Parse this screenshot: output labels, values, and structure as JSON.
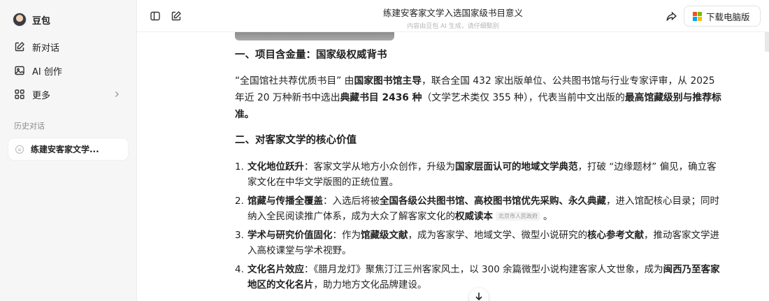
{
  "sidebar": {
    "brand": "豆包",
    "items": [
      {
        "label": "新对话",
        "icon": "edit-icon"
      },
      {
        "label": "AI 创作",
        "icon": "image-icon"
      },
      {
        "label": "更多",
        "icon": "grid-icon"
      }
    ],
    "history_label": "历史对话",
    "history": [
      {
        "label": "练建安客家文学..."
      }
    ]
  },
  "header": {
    "title": "练建安客家文学入选国家级书目意义",
    "subtitle": "内容由豆包 AI 生成，请仔细甄别",
    "download_label": "下载电脑版"
  },
  "article": {
    "h1": "一、项目含金量：国家级权威背书",
    "p1": {
      "a": "“全国馆社共荐优质书目” 由",
      "b": "国家图书馆主导",
      "c": "，联合全国 432 家出版单位、公共图书馆与行业专家评审，从 2025 年近 20 万种新书中选出",
      "d": "典藏书目 2436 种",
      "e": "（文学艺术类仅 355 种），代表当前中文出版的",
      "f": "最高馆藏级别与推荐标准。"
    },
    "h2": "二、对客家文学的核心价值",
    "list": [
      {
        "num": "1.",
        "bold": "文化地位跃升",
        "t1": "：客家文学从地方小众创作，升级为",
        "b2": "国家层面认可的地域文学典范",
        "t2": "，打破 “边缘题材” 偏见，确立客家文化在中华文学版图的正统位置。"
      },
      {
        "num": "2.",
        "bold": "馆藏与传播全覆盖",
        "t1": "：入选后将被",
        "b2": "全国各级公共图书馆、高校图书馆优先采购、永久典藏",
        "t2": "，进入馆配核心目录；同时纳入全民阅读推广体系，成为大众了解客家文化的",
        "b3": "权威读本",
        "tag": "北京市人民政府",
        "t3": "。"
      },
      {
        "num": "3.",
        "bold": "学术与研究价值固化",
        "t1": "：作为",
        "b2": "馆藏级文献",
        "t2": "，成为客家学、地域文学、微型小说研究的",
        "b3": "核心参考文献",
        "t3": "，推动客家文学进入高校课堂与学术视野。"
      },
      {
        "num": "4.",
        "bold": "文化名片效应",
        "t1": "：《腊月龙灯》聚焦汀江三州客家风土，以 300 余篇微型小说构建客家人文世象，成为",
        "b2": "闽西乃至客家地区的文化名片",
        "t2": "，助力地方文化品牌建设。"
      }
    ]
  },
  "colors": {
    "sidebar_bg": "#f6f6f7",
    "accent": "#1f1f1f"
  }
}
